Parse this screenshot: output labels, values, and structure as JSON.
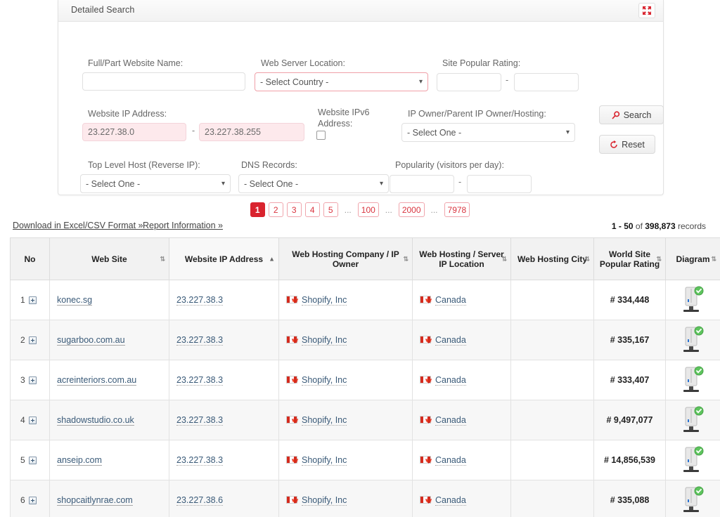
{
  "panel": {
    "title": "Detailed Search",
    "expand_icon": "expand-arrows-icon",
    "fields": {
      "website_name_label": "Full/Part Website Name:",
      "website_name_value": "",
      "website_name_placeholder": "",
      "server_location_label": "Web Server Location:",
      "server_location_value": "- Select Country -",
      "site_rating_label": "Site Popular Rating:",
      "site_rating_from": "",
      "site_rating_to": "",
      "range_separator": "-",
      "ip_address_label": "Website IP Address:",
      "ip_address_from": "23.227.38.0",
      "ip_address_to": "23.227.38.255",
      "ipv6_label": "Website IPv6 Address:",
      "ipv6_checked": false,
      "ip_owner_label": "IP Owner/Parent IP Owner/Hosting:",
      "ip_owner_value": "- Select One -",
      "top_level_host_label": "Top Level Host (Reverse IP):",
      "top_level_host_value": "- Select One -",
      "dns_records_label": "DNS Records:",
      "dns_records_value": "- Select One -",
      "popularity_label": "Popularity (visitors per day):",
      "popularity_from": "",
      "popularity_to": ""
    },
    "buttons": {
      "search_label": "Search",
      "search_icon": "magnifier-icon",
      "reset_label": "Reset",
      "reset_icon": "refresh-icon"
    }
  },
  "pagination": {
    "pages": [
      "1",
      "2",
      "3",
      "4",
      "5",
      "...",
      "100",
      "...",
      "2000",
      "...",
      "7978"
    ],
    "active": "1"
  },
  "toolbar": {
    "download_label": "Download in Excel/CSV Format »",
    "report_label": "Report Information »",
    "records_prefix": "1 - 50",
    "records_mid": "of",
    "records_total": "398,873",
    "records_suffix": "records"
  },
  "table": {
    "columns": [
      {
        "label": "No",
        "sortable": false,
        "sort": "none"
      },
      {
        "label": "Web Site",
        "sortable": true,
        "sort": "none"
      },
      {
        "label": "Website IP Address",
        "sortable": true,
        "sort": "asc"
      },
      {
        "label": "Web Hosting Company / IP Owner",
        "sortable": true,
        "sort": "none"
      },
      {
        "label": "Web Hosting / Server IP Location",
        "sortable": true,
        "sort": "none"
      },
      {
        "label": "Web Hosting City",
        "sortable": true,
        "sort": "none"
      },
      {
        "label": "World Site Popular Rating",
        "sortable": true,
        "sort": "none"
      },
      {
        "label": "Diagram",
        "sortable": true,
        "sort": "none"
      }
    ],
    "rows": [
      {
        "no": "1",
        "site": "konec.sg",
        "ip": "23.227.38.3",
        "company": "Shopify, Inc",
        "location": "Canada",
        "city": "",
        "rating": "# 334,448",
        "diagram": "server-ok-icon"
      },
      {
        "no": "2",
        "site": "sugarboo.com.au",
        "ip": "23.227.38.3",
        "company": "Shopify, Inc",
        "location": "Canada",
        "city": "",
        "rating": "# 335,167",
        "diagram": "server-ok-icon"
      },
      {
        "no": "3",
        "site": "acreinteriors.com.au",
        "ip": "23.227.38.3",
        "company": "Shopify, Inc",
        "location": "Canada",
        "city": "",
        "rating": "# 333,407",
        "diagram": "server-ok-icon"
      },
      {
        "no": "4",
        "site": "shadowstudio.co.uk",
        "ip": "23.227.38.3",
        "company": "Shopify, Inc",
        "location": "Canada",
        "city": "",
        "rating": "# 9,497,077",
        "diagram": "server-ok-icon"
      },
      {
        "no": "5",
        "site": "anseip.com",
        "ip": "23.227.38.3",
        "company": "Shopify, Inc",
        "location": "Canada",
        "city": "",
        "rating": "# 14,856,539",
        "diagram": "server-ok-icon"
      },
      {
        "no": "6",
        "site": "shopcaitlynrae.com",
        "ip": "23.227.38.6",
        "company": "Shopify, Inc",
        "location": "Canada",
        "city": "",
        "rating": "# 335,088",
        "diagram": "server-ok-icon"
      }
    ]
  },
  "colors": {
    "accent_red": "#d9232e",
    "link_blue": "#3a5a78",
    "filled_input_bg": "#fde9ec"
  }
}
